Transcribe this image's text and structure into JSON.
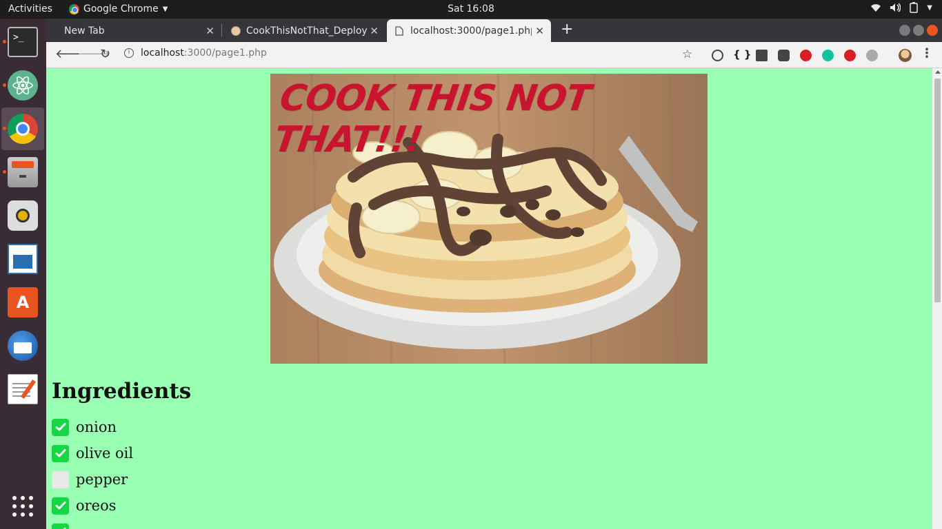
{
  "topbar": {
    "activities": "Activities",
    "app_name": "Google Chrome",
    "clock": "Sat 16:08"
  },
  "dock": {
    "items": [
      {
        "name": "terminal-icon",
        "active": false,
        "running": true
      },
      {
        "name": "atom-icon",
        "active": false,
        "running": true
      },
      {
        "name": "chrome-icon",
        "active": true,
        "running": true
      },
      {
        "name": "files-icon",
        "active": false,
        "running": true
      },
      {
        "name": "rhythmbox-icon",
        "active": false,
        "running": false
      },
      {
        "name": "libreoffice-writer-icon",
        "active": false,
        "running": false
      },
      {
        "name": "software-center-icon",
        "active": false,
        "running": false
      },
      {
        "name": "thunderbird-icon",
        "active": false,
        "running": false
      },
      {
        "name": "text-editor-icon",
        "active": false,
        "running": false
      },
      {
        "name": "show-apps-icon",
        "active": false,
        "running": false
      }
    ]
  },
  "browser": {
    "tabs": [
      {
        "label": "New Tab",
        "active": false
      },
      {
        "label": "CookThisNotThat_Deploy",
        "active": false
      },
      {
        "label": "localhost:3000/page1.php",
        "active": true
      }
    ],
    "url_host": "localhost",
    "url_rest": ":3000/page1.php"
  },
  "page": {
    "hero_title": "COOK THIS NOT THAT!!!",
    "section_title": "Ingredients",
    "ingredients": [
      {
        "label": "onion",
        "checked": true
      },
      {
        "label": "olive oil",
        "checked": true
      },
      {
        "label": "pepper",
        "checked": false
      },
      {
        "label": "oreos",
        "checked": true
      },
      {
        "label": "",
        "checked": true
      }
    ]
  },
  "colors": {
    "page_background": "#99ffb2",
    "checkbox_checked": "#15d643",
    "checkbox_unchecked": "#e8e8e8",
    "hero_title": "#c8142f",
    "ubuntu_orange": "#e95420"
  }
}
